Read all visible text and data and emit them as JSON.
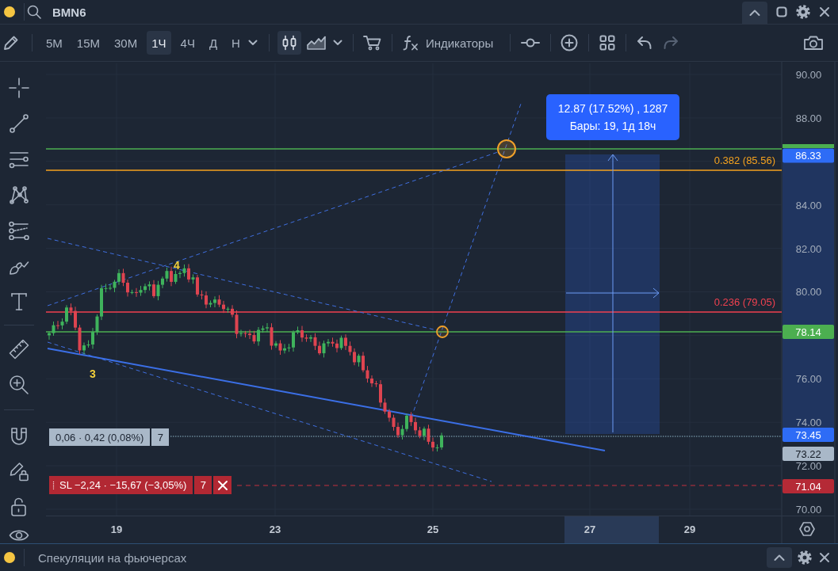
{
  "header": {
    "symbol": "BMN6"
  },
  "toolbar": {
    "intervals": [
      {
        "label": "5М",
        "selected": false
      },
      {
        "label": "15М",
        "selected": false
      },
      {
        "label": "30М",
        "selected": false
      },
      {
        "label": "1Ч",
        "selected": true
      },
      {
        "label": "4Ч",
        "selected": false
      },
      {
        "label": "Д",
        "selected": false
      },
      {
        "label": "Н",
        "selected": false
      }
    ],
    "chart_types": [
      {
        "kind": "candles",
        "selected": true
      },
      {
        "kind": "area",
        "selected": false
      }
    ],
    "indicators": "Индикаторы",
    "history": [
      {
        "kind": "undo",
        "disabled": false
      },
      {
        "kind": "redo",
        "disabled": true
      }
    ]
  },
  "chart": {
    "price_axis": [
      "90.00",
      "88.00",
      "84.00",
      "82.00",
      "80.00",
      "76.00",
      "74.00",
      "72.00",
      "70.00"
    ],
    "time_axis": [
      "19",
      "23",
      "25",
      "27",
      "29"
    ],
    "horizontal_lines": [
      {
        "kind": "line",
        "color": "#4caf50"
      },
      {
        "kind": "fib",
        "color": "#f5a21e",
        "label": "0.382 (85.56)"
      },
      {
        "kind": "fib",
        "color": "#f0414f",
        "label": "0.236 (79.05)"
      },
      {
        "kind": "line",
        "color": "#4caf50",
        "tag": "78.14"
      }
    ],
    "measure": {
      "lines": [
        "12.87 (17.52%) , 1287",
        "Бары: 19, 1д 18ч"
      ]
    },
    "wave_labels": [
      "4",
      "3"
    ],
    "orders": [
      {
        "kind": "position",
        "text": "0,06 · 0,42 (0,08%)",
        "quantity": "7"
      },
      {
        "kind": "stop_loss",
        "text": "SL −2,24 · −15,67 (−3,05%)",
        "quantity": "7"
      }
    ],
    "axis_tags": [
      {
        "text": "86.33",
        "color": "#2e6cf6"
      },
      {
        "text": "73.45",
        "color": "#2e6cf6"
      },
      {
        "text": "73.22",
        "color": "#a9b8c8"
      },
      {
        "text": "71.04",
        "color": "#b52a36"
      }
    ]
  },
  "footer": {
    "title": "Спекуляции на фьючерсах"
  }
}
